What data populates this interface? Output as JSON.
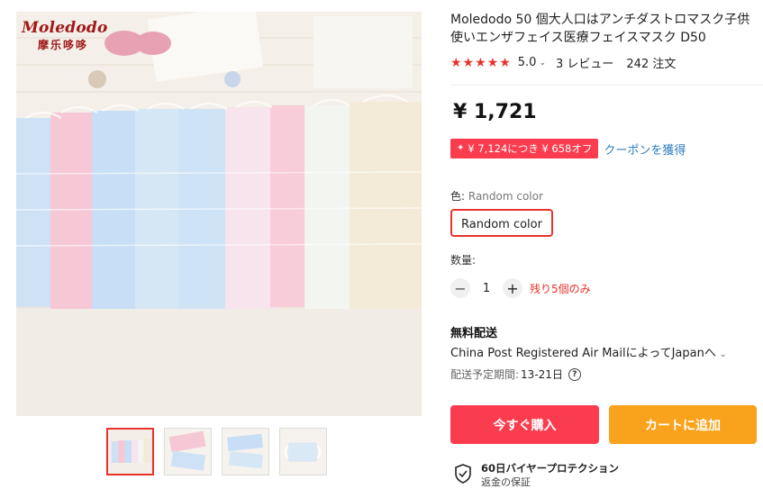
{
  "product": {
    "brand_logo": "Moledodo",
    "brand_logo_sub": "摩乐哆哆",
    "title": "Moledodo 50 個大人口はアンチダストロマスク子供使いエンザフェイス医療フェイスマスク D50",
    "rating": "5.0",
    "reviews": "3 レビュー",
    "orders": "242 注文",
    "price": "¥ 1,721"
  },
  "coupon": {
    "badge": "¥ 7,124につき ¥ 658オフ",
    "link": "クーポンを獲得"
  },
  "color": {
    "label": "色:",
    "selected": "Random color",
    "option": "Random color"
  },
  "quantity": {
    "label": "数量:",
    "value": "1",
    "stock_note": "残り5個のみ"
  },
  "shipping": {
    "title": "無料配送",
    "method": "China Post Registered Air MailによってJapanへ",
    "eta_label": "配送予定期間:",
    "eta_days": "13-21日"
  },
  "actions": {
    "buy_now": "今すぐ購入",
    "add_to_cart": "カートに追加"
  },
  "protection": {
    "title": "60日バイヤープロテクション",
    "subtitle": "返金の保証"
  },
  "icons": [
    "star-icon",
    "chevron-down-icon",
    "sparkle-icon",
    "minus-icon",
    "plus-icon",
    "help-icon",
    "shield-check-icon"
  ],
  "colors": {
    "accent_red": "#fb3c4f",
    "cart_orange": "#f9a21b",
    "link_blue": "#2e7dbd"
  }
}
